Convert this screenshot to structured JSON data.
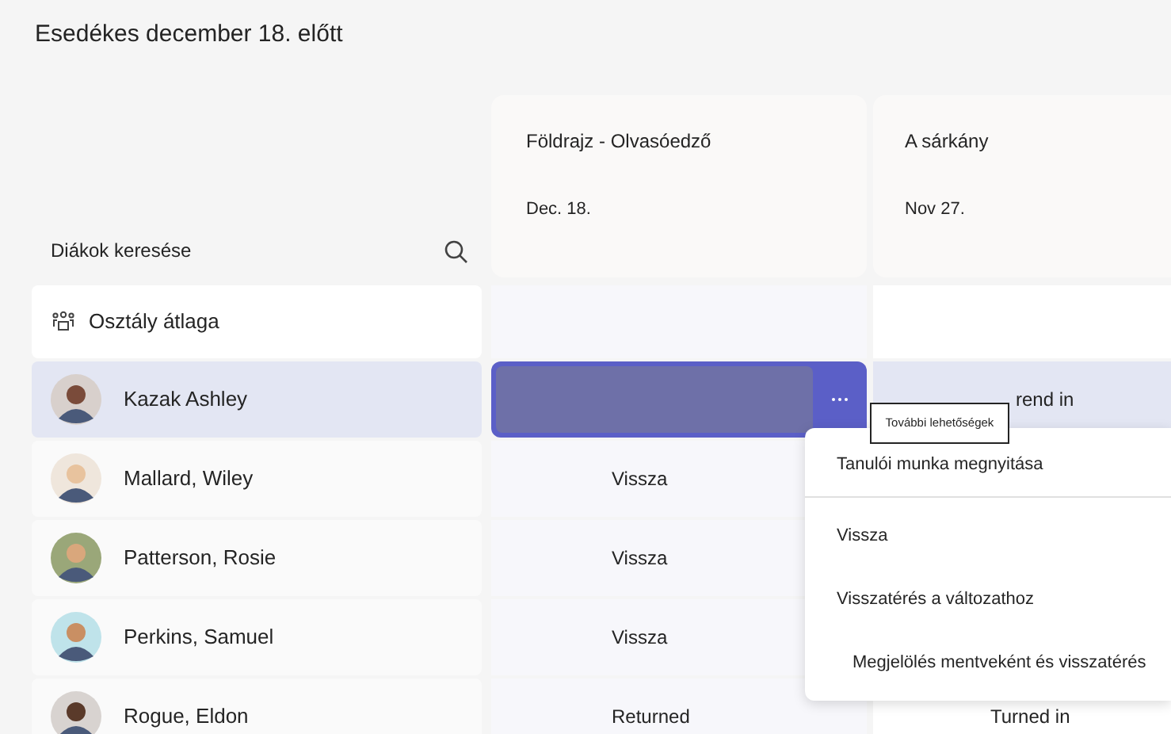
{
  "heading": "Esedékes december 18. előtt",
  "search": {
    "placeholder": "Diákok keresése"
  },
  "assignments": [
    {
      "title": "Földrajz - Olvasóedző",
      "due": "Dec. 18."
    },
    {
      "title": "A sárkány",
      "due": "Nov 27."
    }
  ],
  "class_average": {
    "label": "Osztály átlaga"
  },
  "students": [
    {
      "name": "Kazak Ashley",
      "selected": true,
      "cell_2": "rend in"
    },
    {
      "name": "Mallard, Wiley",
      "selected": false,
      "cell_1": "Vissza"
    },
    {
      "name": "Patterson, Rosie",
      "selected": false,
      "cell_1": "Vissza"
    },
    {
      "name": "Perkins, Samuel",
      "selected": false,
      "cell_1": "Vissza"
    },
    {
      "name": "Rogue, Eldon",
      "selected": false,
      "cell_1": "Returned",
      "cell_2": "Turned in"
    }
  ],
  "tooltip": "További lehetőségek",
  "menu": [
    {
      "label": "Tanulói munka megnyitása",
      "divider_after": true,
      "indented": false
    },
    {
      "label": "Vissza",
      "divider_after": false,
      "indented": false
    },
    {
      "label": "Visszatérés a változathoz",
      "divider_after": false,
      "indented": false
    },
    {
      "label": "Megjelölés mentveként és visszatérés",
      "divider_after": false,
      "indented": true
    }
  ]
}
